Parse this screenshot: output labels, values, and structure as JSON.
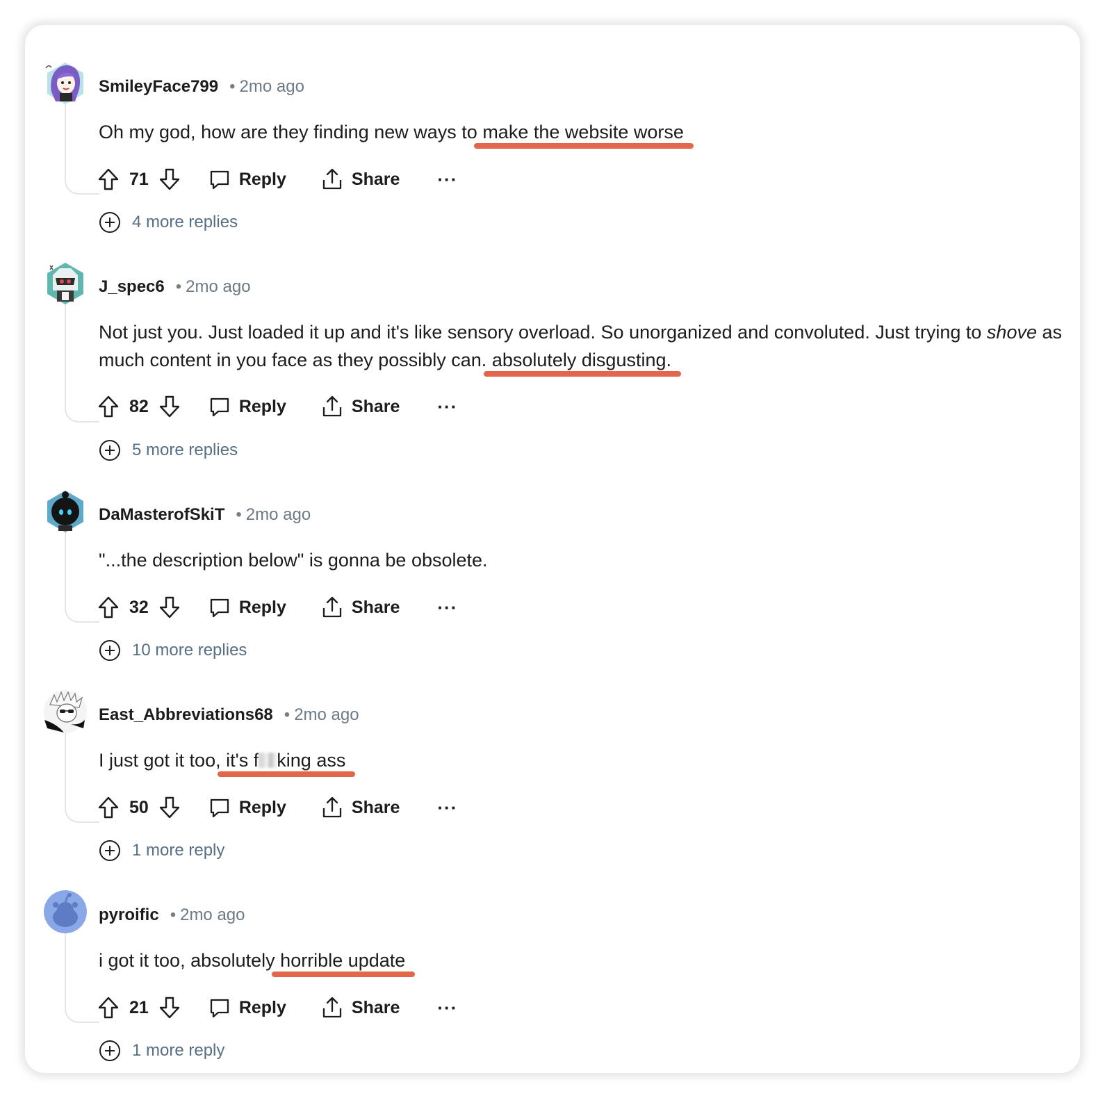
{
  "comments": [
    {
      "username": "SmileyFace799",
      "time": "2mo ago",
      "text_before": "Oh my god, how are they finding new ways to",
      "text_highlight": "make the website worse",
      "text_after": "",
      "score": "71",
      "reply_label": "Reply",
      "share_label": "Share",
      "more_label": "···",
      "more_replies": "4 more replies",
      "avatar": "purple-haired-girl-avatar"
    },
    {
      "username": "J_spec6",
      "time": "2mo ago",
      "text_before": "Not just you. Just loaded it up and it's like sensory overload. So unorganized and convoluted. Just trying to",
      "text_emph": "shove",
      "text_mid": "as much content in you face as they possibly can.",
      "text_highlight": "absolutely disgusting.",
      "score": "82",
      "reply_label": "Reply",
      "share_label": "Share",
      "more_label": "···",
      "more_replies": "5 more replies",
      "avatar": "robot-avatar"
    },
    {
      "username": "DaMasterofSkiT",
      "time": "2mo ago",
      "text": "\"...the description below\" is gonna be obsolete.",
      "score": "32",
      "reply_label": "Reply",
      "share_label": "Share",
      "more_label": "···",
      "more_replies": "10 more replies",
      "avatar": "dark-character-avatar"
    },
    {
      "username": "East_Abbreviations68",
      "time": "2mo ago",
      "text_before": "I just got it too,",
      "text_highlight_a": "it's f",
      "text_highlight_b": "king ass",
      "score": "50",
      "reply_label": "Reply",
      "share_label": "Share",
      "more_label": "···",
      "more_replies": "1 more reply",
      "avatar": "sketch-character-avatar"
    },
    {
      "username": "pyroific",
      "time": "2mo ago",
      "text_before": "i got it too, absolutely",
      "text_highlight": "horrible update",
      "score": "21",
      "reply_label": "Reply",
      "share_label": "Share",
      "more_label": "···",
      "more_replies": "1 more reply",
      "avatar": "default-snoo-avatar"
    }
  ],
  "colors": {
    "highlight_underline": "#e2674a",
    "thread_line": "#e3e6e8",
    "meta_text": "#6c7a86",
    "more_replies_text": "#576f84"
  }
}
